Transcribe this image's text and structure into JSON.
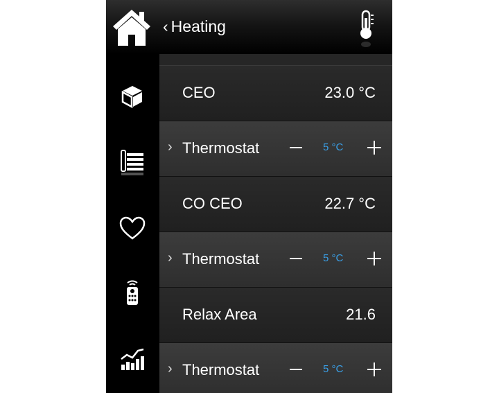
{
  "header": {
    "back_chevron": "‹",
    "title": "Heating",
    "home_icon": "home-icon",
    "right_icon": "thermometer-icon"
  },
  "sidebar": {
    "items": [
      {
        "icon": "cube-icon"
      },
      {
        "icon": "radiator-icon",
        "active": true
      },
      {
        "icon": "heart-icon"
      },
      {
        "icon": "remote-control-icon"
      },
      {
        "icon": "stats-chart-icon"
      }
    ]
  },
  "rows": [
    {
      "type": "info",
      "name": "CEO",
      "value": "23.0 °C"
    },
    {
      "type": "ctrl",
      "arrow": "›",
      "name": "Thermostat",
      "setpoint": "5 °C"
    },
    {
      "type": "info",
      "name": "CO CEO",
      "value": "22.7 °C"
    },
    {
      "type": "ctrl",
      "arrow": "›",
      "name": "Thermostat",
      "setpoint": "5 °C"
    },
    {
      "type": "info",
      "name": "Relax Area",
      "value": "21.6"
    },
    {
      "type": "ctrl",
      "arrow": "›",
      "name": "Thermostat",
      "setpoint": "5 °C"
    }
  ],
  "colors": {
    "accent": "#3aa0e8",
    "background": "#000000"
  }
}
